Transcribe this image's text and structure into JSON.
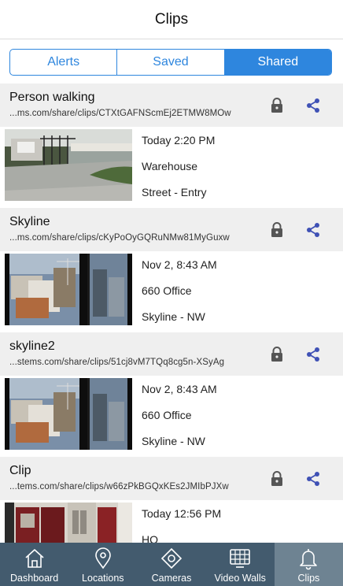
{
  "header": {
    "title": "Clips"
  },
  "segments": [
    {
      "label": "Alerts",
      "active": false
    },
    {
      "label": "Saved",
      "active": false
    },
    {
      "label": "Shared",
      "active": true
    }
  ],
  "clips": [
    {
      "title": "Person walking",
      "url": "...ms.com/share/clips/CTXtGAFNScmEj2ETMW8MOw",
      "time": "Today 2:20 PM",
      "location": "Warehouse",
      "camera": "Street - Entry",
      "thumbnail": "street-entry"
    },
    {
      "title": "Skyline",
      "url": "...ms.com/share/clips/cKyPoOyGQRuNMw81MyGuxw",
      "time": "Nov 2, 8:43 AM",
      "location": "660 Office",
      "camera": "Skyline - NW",
      "thumbnail": "skyline"
    },
    {
      "title": "skyline2",
      "url": "...stems.com/share/clips/51cj8vM7TQq8cg5n-XSyAg",
      "time": "Nov 2, 8:43 AM",
      "location": "660 Office",
      "camera": "Skyline - NW",
      "thumbnail": "skyline"
    },
    {
      "title": "Clip",
      "url": "...tems.com/share/clips/w66zPkBGQxKEs2JMIbPJXw",
      "time": "Today 12:56 PM",
      "location": "HQ",
      "camera": "",
      "thumbnail": "doors"
    }
  ],
  "icons": {
    "lock": "lock-icon",
    "share": "share-icon"
  },
  "colors": {
    "accent": "#2e86de",
    "share_icon": "#3f51b5",
    "tabbar": "#435b6e",
    "tabbar_active": "#6e8392",
    "row_header": "#efefef"
  },
  "tabbar": [
    {
      "label": "Dashboard",
      "icon": "house-icon",
      "active": false
    },
    {
      "label": "Locations",
      "icon": "map-pin-icon",
      "active": false
    },
    {
      "label": "Cameras",
      "icon": "camera-diamond-icon",
      "active": false
    },
    {
      "label": "Video Walls",
      "icon": "video-wall-icon",
      "active": false
    },
    {
      "label": "Clips",
      "icon": "bell-icon",
      "active": true
    }
  ]
}
